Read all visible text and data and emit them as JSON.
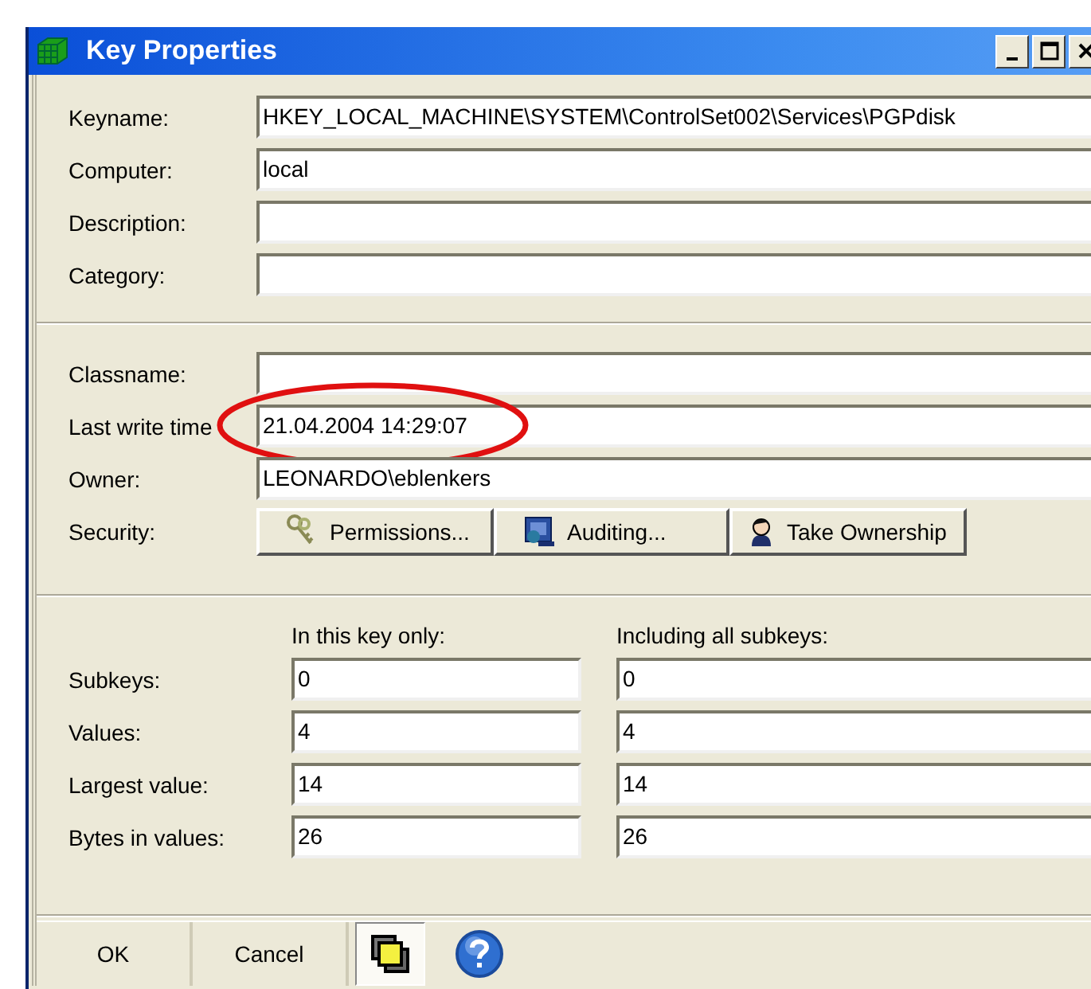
{
  "window": {
    "title": "Key Properties"
  },
  "general": [
    {
      "label": "Keyname:",
      "value": "HKEY_LOCAL_MACHINE\\SYSTEM\\ControlSet002\\Services\\PGPdisk"
    },
    {
      "label": "Computer:",
      "value": "local"
    },
    {
      "label": "Description:"
    },
    {
      "label": "Category:"
    }
  ],
  "details": [
    {
      "label": "Classname:"
    },
    {
      "label": "Last write time",
      "value": "21.04.2004 14:29:07",
      "annotation": {
        "kind": "ellipse"
      }
    },
    {
      "label": "Owner:",
      "value": "LEONARDO\\eblenkers"
    }
  ],
  "security": {
    "label": "Security:",
    "buttons": [
      {
        "kind": "keys",
        "label": "Permissions..."
      },
      {
        "kind": "monitor",
        "label": "Auditing..."
      },
      {
        "kind": "person",
        "label": "Take Ownership"
      }
    ]
  },
  "statistics": {
    "columns": [
      "In this key only:",
      "Including all subkeys:"
    ],
    "rows": [
      {
        "label": "Subkeys:",
        "values": [
          "0",
          "0"
        ]
      },
      {
        "label": "Values:",
        "values": [
          "4",
          "4"
        ]
      },
      {
        "label": "Largest value:",
        "values": [
          "14",
          "14"
        ]
      },
      {
        "label": "Bytes in values:",
        "values": [
          "26",
          "26"
        ]
      }
    ]
  },
  "footer": {
    "buttons": [
      "OK",
      "Cancel"
    ],
    "windows_toggle": {
      "pressed": true
    }
  }
}
